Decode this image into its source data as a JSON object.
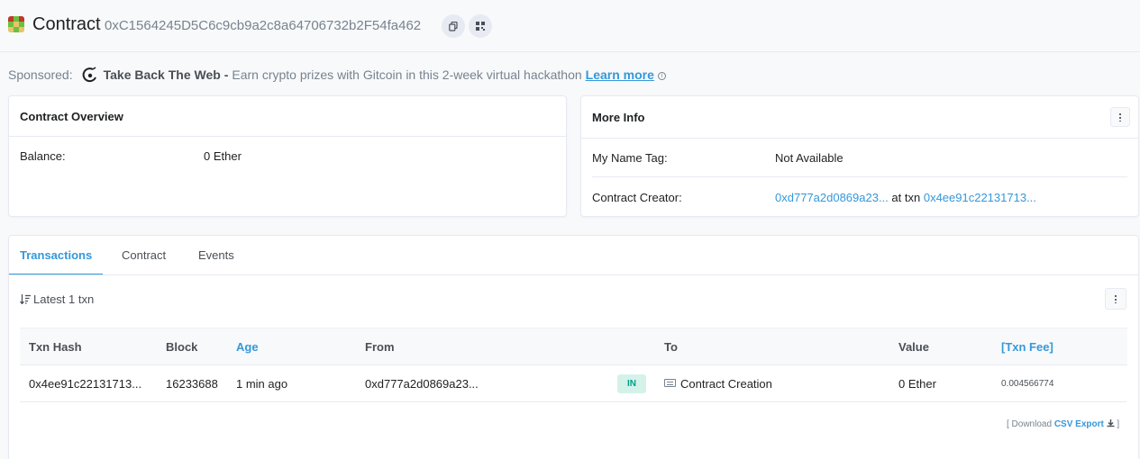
{
  "header": {
    "title": "Contract",
    "address": "0xC1564245D5C6c9cb9a2c8a64706732b2F54fa462",
    "icons": [
      "copy-icon",
      "qr-code-icon"
    ]
  },
  "sponsored": {
    "label": "Sponsored:",
    "brand": "Take Back The Web -",
    "text": "Earn crypto prizes with Gitcoin in this 2-week virtual hackathon",
    "link": "Learn more",
    "info_glyph": "i"
  },
  "overview": {
    "title": "Contract Overview",
    "balance_label": "Balance:",
    "balance_value": "0 Ether"
  },
  "more_info": {
    "title": "More Info",
    "name_tag_label": "My Name Tag:",
    "name_tag_value": "Not Available",
    "creator_label": "Contract Creator:",
    "creator_address": "0xd777a2d0869a23...",
    "at_txn": "at txn",
    "creator_txn": "0x4ee91c22131713..."
  },
  "tabs": [
    "Transactions",
    "Contract",
    "Events"
  ],
  "transactions": {
    "summary": "Latest 1 txn",
    "columns": [
      "Txn Hash",
      "Block",
      "Age",
      "From",
      "To",
      "Value",
      "[Txn Fee]"
    ],
    "rows": [
      {
        "hash": "0x4ee91c22131713...",
        "block": "16233688",
        "age": "1 min ago",
        "from": "0xd777a2d0869a23...",
        "direction": "IN",
        "to": "Contract Creation",
        "value": "0 Ether",
        "fee": "0.004566774"
      }
    ],
    "download_prefix": "[ Download",
    "download_link": "CSV Export",
    "download_suffix": "]"
  },
  "colors": {
    "accent": "#3498db",
    "in_badge_bg": "#d4f2ea",
    "in_badge_text": "#00a186"
  }
}
